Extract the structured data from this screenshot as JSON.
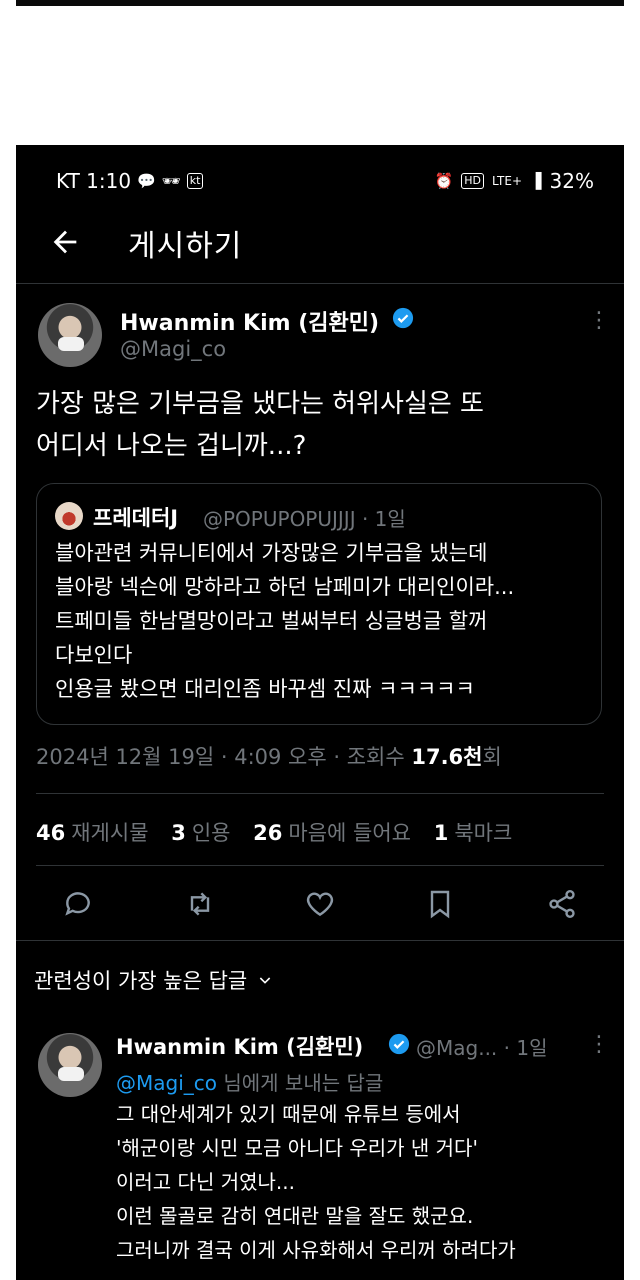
{
  "status_bar": {
    "carrier_time": "KT 1:10",
    "left_icons": [
      "chat-bubble-icon",
      "incognito-icon",
      "kakao-kt-icon"
    ],
    "right_icons": [
      "alarm-icon",
      "hd-icon",
      "lte-plus-icon",
      "signal-icon"
    ],
    "battery": "32%"
  },
  "header": {
    "title": "게시하기"
  },
  "tweet": {
    "author": "Hwanmin Kim (김환민)",
    "handle": "@Magi_co",
    "text_lines": [
      "가장 많은 기부금을 냈다는 허위사실은 또",
      "어디서 나오는 겁니까...?"
    ],
    "quote": {
      "author": "프레데터J",
      "handle_time": "@POPUPOPUJJJJ · 1일",
      "lines": [
        "블아관련 커뮤니티에서 가장많은 기부금을 냈는데",
        "블아랑 넥슨에 망하라고 하던 남페미가 대리인이라...",
        "트페미들 한남멸망이라고 벌써부터 싱글벙글 할꺼",
        "다보인다",
        "인용글 봤으면 대리인좀 바꾸셈 진짜 ㅋㅋㅋㅋㅋ"
      ]
    },
    "meta": {
      "datetime": "2024년 12월 19일 · 4:09 오후 · 조회수 ",
      "views": "17.6천",
      "views_suffix": "회"
    },
    "stats": {
      "retweets_num": "46",
      "retweets_label": "재게시물",
      "quotes_num": "3",
      "quotes_label": "인용",
      "likes_num": "26",
      "likes_label": "마음에 들어요",
      "bookmarks_num": "1",
      "bookmarks_label": "북마크"
    }
  },
  "relevance_label": "관련성이 가장 높은 답글",
  "reply": {
    "author": "Hwanmin Kim (김환민)",
    "handle_time": "@Mag... · 1일",
    "reply_to_mention": "@Magi_co",
    "reply_to_suffix": " 님에게 보내는 답글",
    "lines": [
      "그 대안세계가 있기 때문에 유튜브 등에서",
      "'해군이랑 시민 모금 아니다 우리가 낸 거다'",
      "이러고 다닌 거였나...",
      "이런 몰골로 감히 연대란 말을 잘도 했군요.",
      "그러니까 결국 이게 사유화해서 우리꺼 하려다가"
    ]
  },
  "colors": {
    "background": "#000000",
    "accent": "#1d9bf0",
    "muted": "#71767b",
    "divider": "#2f3336"
  }
}
